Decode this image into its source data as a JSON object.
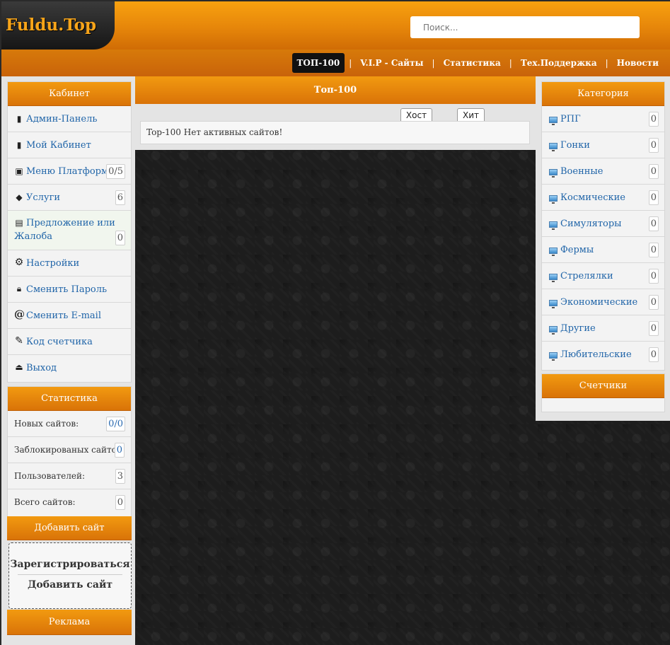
{
  "header": {
    "logo": "Fuldu.Top",
    "search_placeholder": "Поиск..."
  },
  "nav": {
    "items": [
      "ТОП-100",
      "V.I.P - Сайты",
      "Статистика",
      "Тех.Поддержка",
      "Новости"
    ],
    "separator": "|"
  },
  "cabinet": {
    "title": "Кабинет",
    "items": [
      {
        "label": "Админ-Панель",
        "icon": "book-icon"
      },
      {
        "label": "Мой Кабинет",
        "icon": "book-icon"
      },
      {
        "label": "Меню Платформ",
        "icon": "platform-icon",
        "count": "0/5"
      },
      {
        "label": "Услуги",
        "icon": "tag-icon",
        "count": "6"
      },
      {
        "label": "Предложение или",
        "label2": "Жалоба",
        "icon": "chat-icon",
        "count": "0"
      },
      {
        "label": "Настройки",
        "icon": "gear-icon"
      },
      {
        "label": "Сменить Пароль",
        "icon": "lock-icon"
      },
      {
        "label": "Сменить E-mail",
        "icon": "at-icon"
      },
      {
        "label": "Код счетчика",
        "icon": "pencil-icon"
      },
      {
        "label": "Выход",
        "icon": "exit-icon"
      }
    ]
  },
  "stats": {
    "title": "Статистика",
    "rows": [
      {
        "label": "Новых сайтов:",
        "value": "0/0"
      },
      {
        "label": "Заблокированых сайтов:",
        "value": "0"
      },
      {
        "label": "Пользователей:",
        "value": "3"
      },
      {
        "label": "Всего сайтов:",
        "value": "0"
      }
    ]
  },
  "add_site": {
    "title": "Добавить сайт",
    "register": "Зарегистрироваться",
    "add": "Добавить сайт"
  },
  "ads": {
    "title": "Реклама"
  },
  "main": {
    "title": "Топ-100",
    "col_host": "Хост",
    "col_hit": "Хит",
    "empty": "Top-100 Нет активных сайтов!"
  },
  "categories": {
    "title": "Категория",
    "items": [
      {
        "label": "РПГ",
        "count": "0"
      },
      {
        "label": "Гонки",
        "count": "0"
      },
      {
        "label": "Военные",
        "count": "0"
      },
      {
        "label": "Космические",
        "count": "0"
      },
      {
        "label": "Симуляторы",
        "count": "0"
      },
      {
        "label": "Фермы",
        "count": "0"
      },
      {
        "label": "Стрелялки",
        "count": "0"
      },
      {
        "label": "Экономические",
        "count": "0"
      },
      {
        "label": "Другие",
        "count": "0"
      },
      {
        "label": "Любительские",
        "count": "0"
      }
    ]
  },
  "counters": {
    "title": "Счетчики"
  },
  "colors": {
    "accent": "#e6860a",
    "link": "#1f64a8"
  }
}
